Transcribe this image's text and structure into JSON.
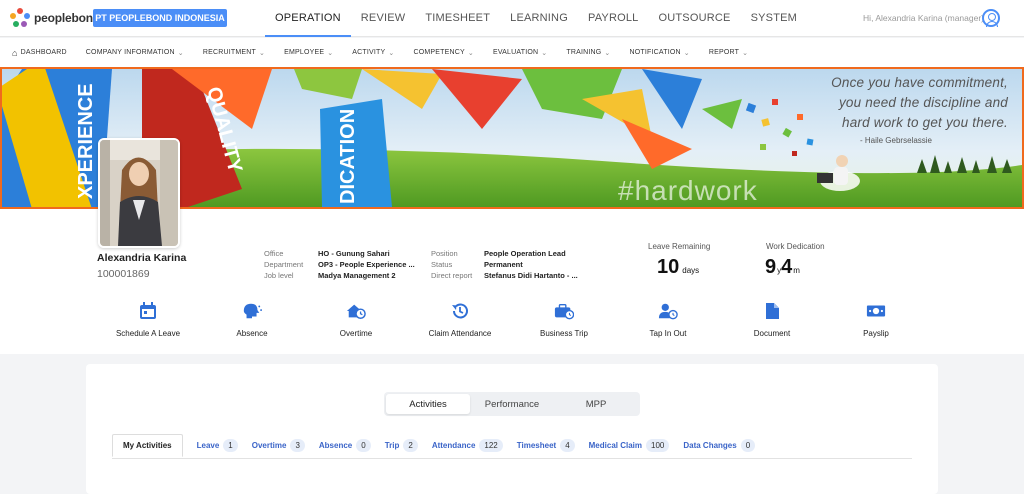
{
  "brand": {
    "logo_text": "peoplebond",
    "company": "PT PEOPLEBOND INDONESIA"
  },
  "main_nav": [
    {
      "label": "OPERATION",
      "active": true
    },
    {
      "label": "REVIEW"
    },
    {
      "label": "TIMESHEET"
    },
    {
      "label": "LEARNING"
    },
    {
      "label": "PAYROLL"
    },
    {
      "label": "OUTSOURCE"
    },
    {
      "label": "SYSTEM"
    }
  ],
  "user": {
    "greeting": "Hi, Alexandria Karina (manager)"
  },
  "sub_nav": [
    {
      "label": "DASHBOARD"
    },
    {
      "label": "COMPANY INFORMATION"
    },
    {
      "label": "RECRUITMENT"
    },
    {
      "label": "EMPLOYEE"
    },
    {
      "label": "ACTIVITY"
    },
    {
      "label": "COMPETENCY"
    },
    {
      "label": "EVALUATION"
    },
    {
      "label": "TRAINING"
    },
    {
      "label": "NOTIFICATION"
    },
    {
      "label": "REPORT"
    }
  ],
  "banner": {
    "quote_lines": [
      "Once you have commitment,",
      "you need the discipline  and",
      "hard work to get you there."
    ],
    "author": "- Haile Gebrselassie",
    "hashtag": "#hardwork",
    "words": [
      "XPERIENCE",
      "QUALITY",
      "DICATION"
    ]
  },
  "profile": {
    "name": "Alexandria Karina",
    "id": "100001869",
    "office_label": "Office",
    "office": "HO - Gunung Sahari",
    "department_label": "Department",
    "department": "OP3 - People Experience ...",
    "joblevel_label": "Job level",
    "joblevel": "Madya Management 2",
    "position_label": "Position",
    "position": "People Operation Lead",
    "status_label": "Status",
    "status": "Permanent",
    "direct_label": "Direct report",
    "direct": "Stefanus Didi Hartanto - ..."
  },
  "stats": {
    "leave_label": "Leave Remaining",
    "leave_value": "10",
    "leave_unit": "days",
    "dedication_label": "Work Dedication",
    "ded_years": "9",
    "ded_years_unit": "y",
    "ded_months": "4",
    "ded_months_unit": "m"
  },
  "quick_actions": [
    {
      "label": "Schedule A Leave",
      "icon": "calendar-icon"
    },
    {
      "label": "Absence",
      "icon": "absence-icon"
    },
    {
      "label": "Overtime",
      "icon": "home-clock-icon"
    },
    {
      "label": "Claim Attendance",
      "icon": "history-icon"
    },
    {
      "label": "Business Trip",
      "icon": "briefcase-icon"
    },
    {
      "label": "Tap In Out",
      "icon": "user-clock-icon"
    },
    {
      "label": "Document",
      "icon": "document-icon"
    },
    {
      "label": "Payslip",
      "icon": "money-icon"
    }
  ],
  "segments": [
    {
      "label": "Activities",
      "active": true
    },
    {
      "label": "Performance"
    },
    {
      "label": "MPP"
    }
  ],
  "activity_tabs": [
    {
      "label": "My Activities",
      "active": true
    },
    {
      "label": "Leave",
      "count": "1"
    },
    {
      "label": "Overtime",
      "count": "3"
    },
    {
      "label": "Absence",
      "count": "0"
    },
    {
      "label": "Trip",
      "count": "2"
    },
    {
      "label": "Attendance",
      "count": "122"
    },
    {
      "label": "Timesheet",
      "count": "4"
    },
    {
      "label": "Medical Claim",
      "count": "100"
    },
    {
      "label": "Data Changes",
      "count": "0"
    }
  ],
  "colors": {
    "accent": "#4b8ef7",
    "highlight_border": "#f06a1d",
    "link": "#3a64c8"
  }
}
